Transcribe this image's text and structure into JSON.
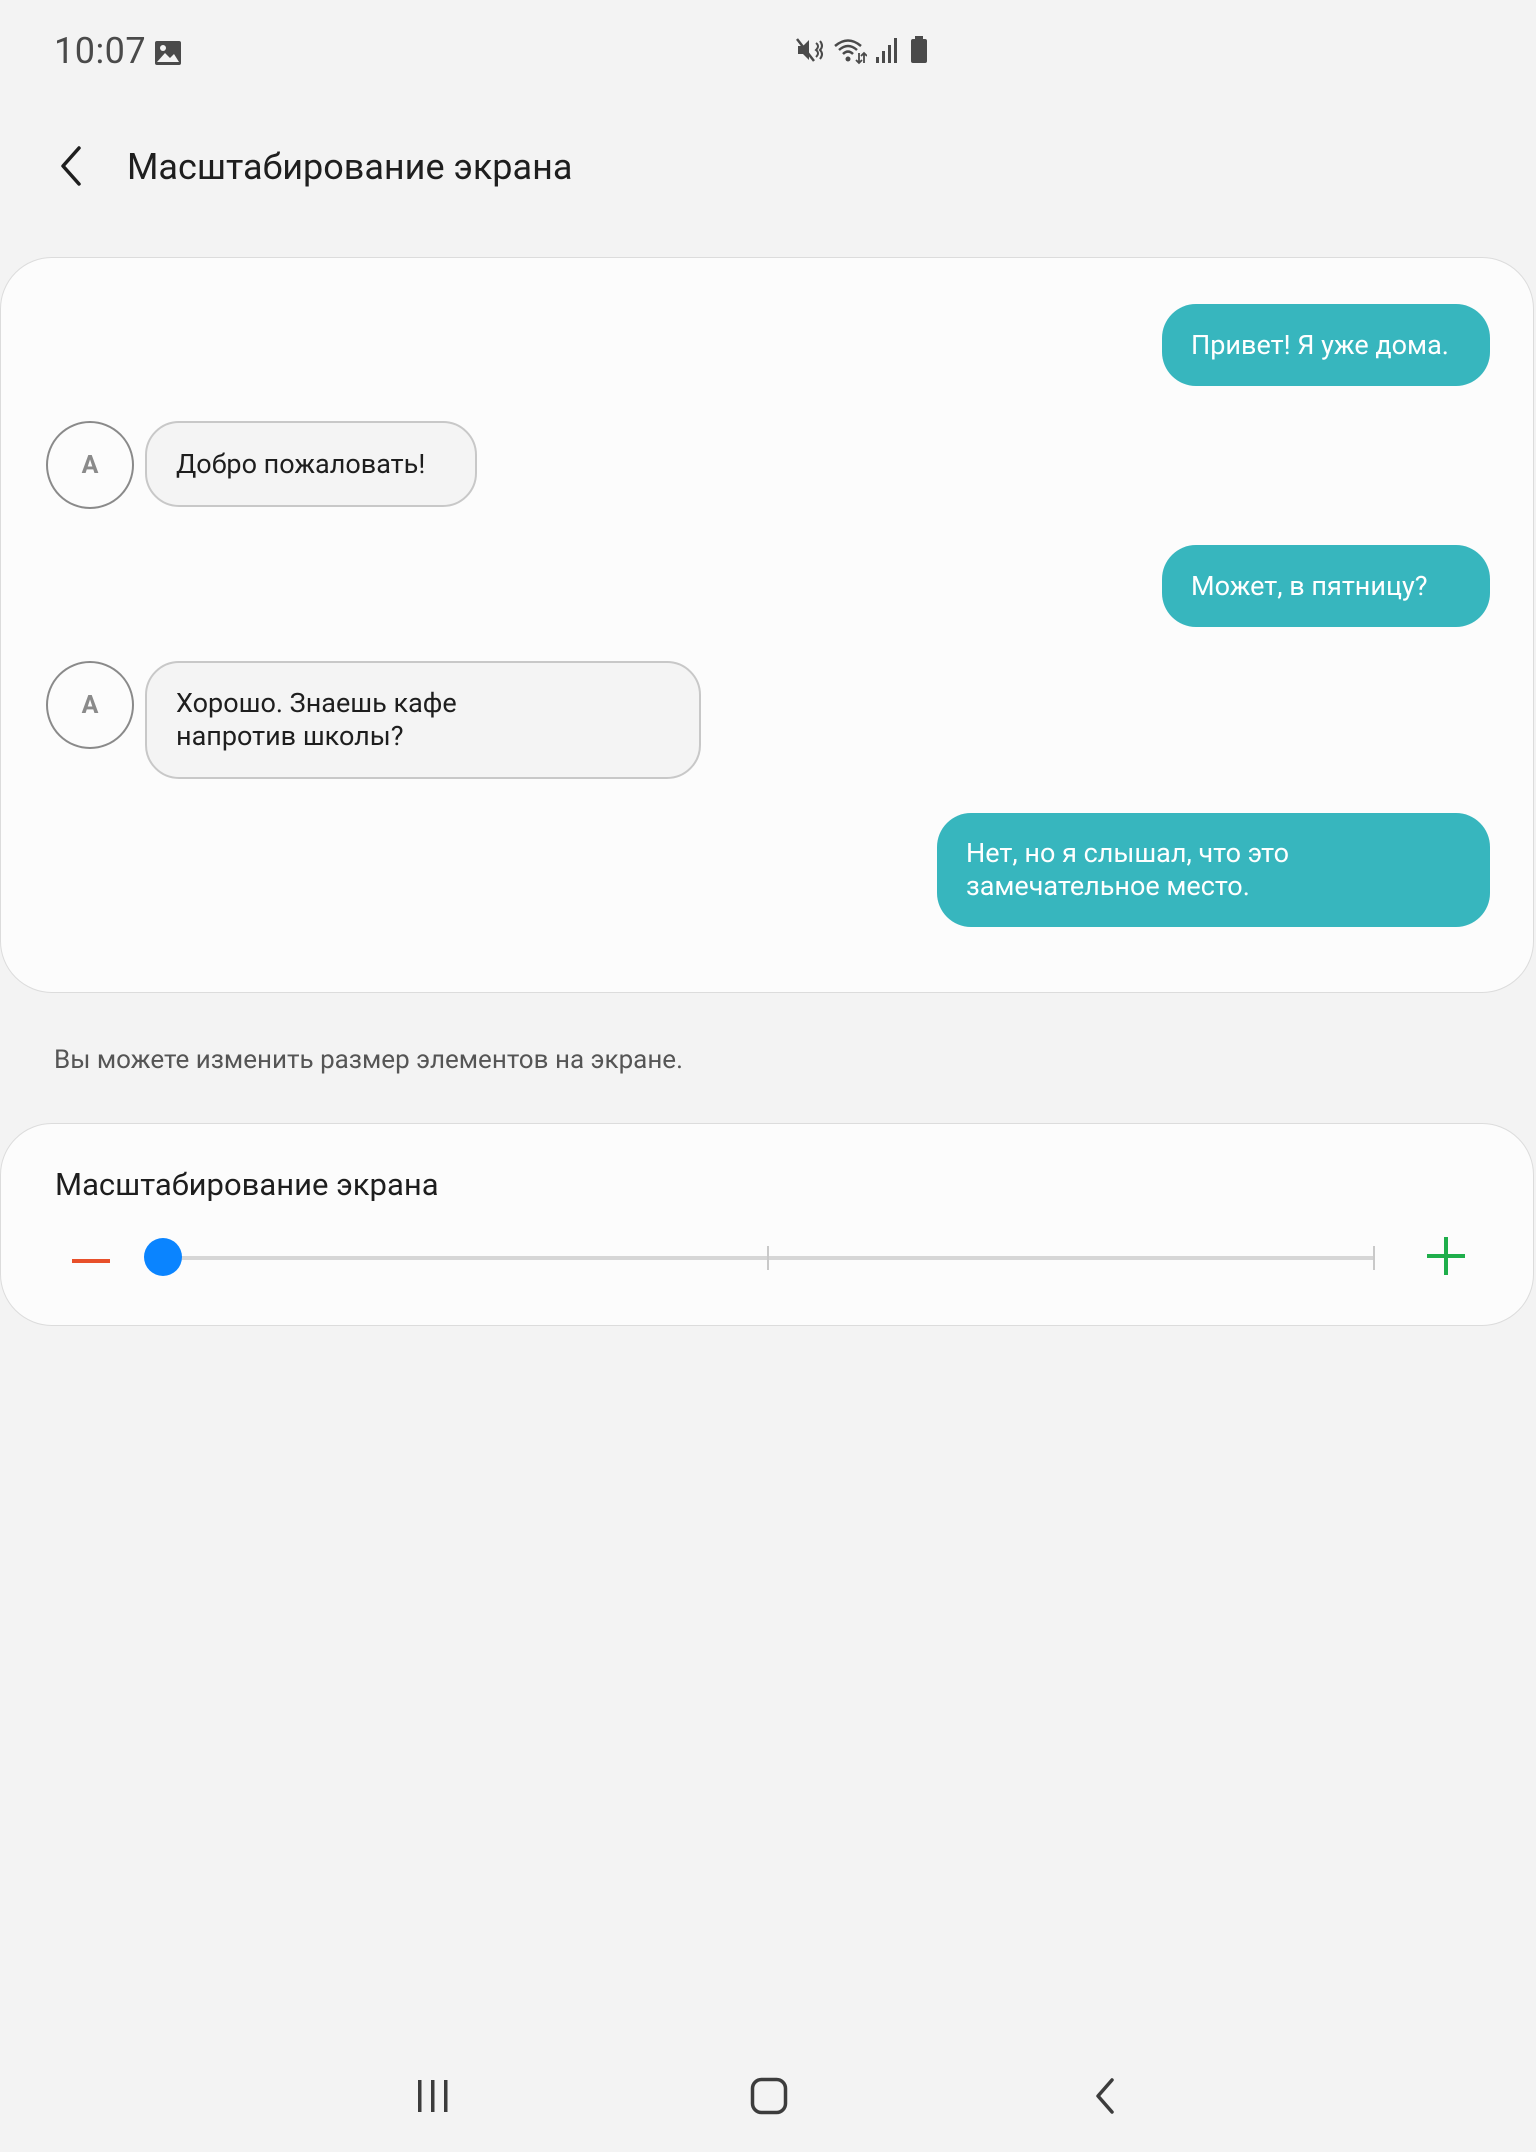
{
  "status_bar": {
    "time": "10:07",
    "icons": [
      "gallery-icon",
      "mute-vibrate-icon",
      "wifi-icon",
      "signal-icon",
      "battery-icon"
    ]
  },
  "header": {
    "title": "Масштабирование экрана",
    "back_icon": "chevron-left-icon"
  },
  "preview": {
    "messages": [
      {
        "direction": "outgoing",
        "text": "Привет! Я уже дома."
      },
      {
        "direction": "incoming",
        "avatar": "A",
        "text": "Добро пожаловать!"
      },
      {
        "direction": "outgoing",
        "text": "Может, в пятницу?"
      },
      {
        "direction": "incoming",
        "avatar": "A",
        "text": "Хорошо. Знаешь кафе напротив школы?"
      },
      {
        "direction": "outgoing",
        "text": "Нет, но я слышал, что это замечательное место."
      }
    ]
  },
  "description": "Вы можете изменить размер элементов на экране.",
  "zoom": {
    "title": "Масштабирование экрана",
    "levels": 3,
    "selected_index": 0,
    "minus_icon": "minus-icon",
    "plus_icon": "plus-icon"
  },
  "nav_bar": {
    "icons": [
      "recent-apps-icon",
      "home-icon",
      "back-icon"
    ]
  },
  "colors": {
    "accent": "#0a84ff",
    "outgoing_bubble": "#37b6be",
    "minus": "#e8502a",
    "plus": "#1fae4b",
    "background": "#f3f3f3"
  }
}
